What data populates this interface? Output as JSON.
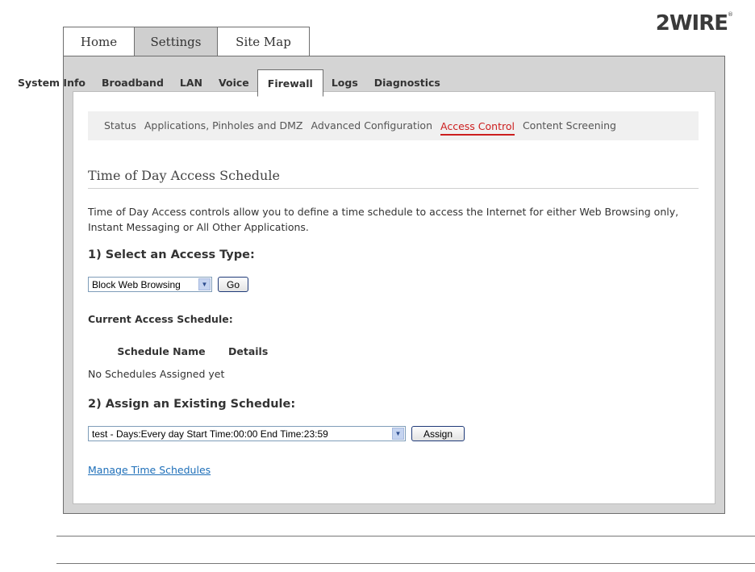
{
  "brand": {
    "logo_text": "2WIRE",
    "logo_mark": "®"
  },
  "top_tabs": [
    {
      "label": "Home"
    },
    {
      "label": "Settings"
    },
    {
      "label": "Site Map"
    }
  ],
  "subnav": [
    {
      "label": "System Info"
    },
    {
      "label": "Broadband"
    },
    {
      "label": "LAN"
    },
    {
      "label": "Voice"
    },
    {
      "label": "Firewall"
    },
    {
      "label": "Logs"
    },
    {
      "label": "Diagnostics"
    }
  ],
  "thirdnav": [
    {
      "label": "Status"
    },
    {
      "label": "Applications, Pinholes and DMZ"
    },
    {
      "label": "Advanced Configuration"
    },
    {
      "label": "Access Control"
    },
    {
      "label": "Content Screening"
    }
  ],
  "content": {
    "section_title": "Time of Day Access Schedule",
    "description": "Time of Day Access controls allow you to define a time schedule to access the Internet for either Web Browsing only, Instant Messaging or All Other Applications.",
    "step1_heading": "1) Select an Access Type:",
    "access_type_select": {
      "value": "Block Web Browsing"
    },
    "go_button": "Go",
    "current_schedule_heading": "Current Access Schedule:",
    "table": {
      "columns": [
        "Schedule Name",
        "Details"
      ],
      "empty_text": "No Schedules Assigned yet"
    },
    "step2_heading": "2) Assign an Existing Schedule:",
    "schedule_select": {
      "value": "test - Days:Every day  Start Time:00:00  End Time:23:59"
    },
    "assign_button": "Assign",
    "manage_link": "Manage Time Schedules"
  },
  "colors": {
    "active_link": "#cc1e1e",
    "link": "#1e6fb9",
    "panel_bg": "#d4d4d4",
    "active_top_tab": "#cfcfcf"
  }
}
